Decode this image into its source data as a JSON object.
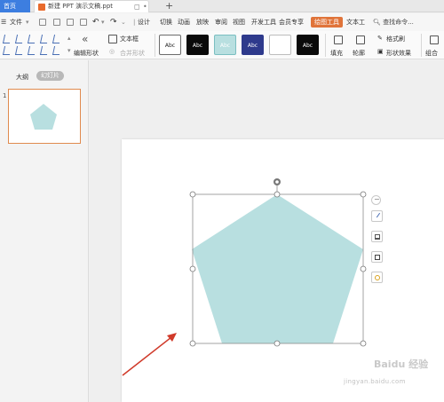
{
  "titlebar": {
    "home_tab": "首页",
    "doc_title": "新建 PPT 演示文稿.ppt",
    "new_tab": "+"
  },
  "menubar": {
    "file": "文件",
    "tabs": [
      "设计",
      "切换",
      "动画",
      "放映",
      "审阅",
      "视图",
      "开发工具",
      "会员专享"
    ],
    "active_tab": "绘图工具",
    "text_tool_tab": "文本工",
    "search": "查找命令..."
  },
  "ribbon": {
    "edit_shape": "编辑形状",
    "text_box": "文本框",
    "merge_shape": "合并形状",
    "style_label": "Abc",
    "fill": "填充",
    "outline": "轮廓",
    "format_painter": "格式刷",
    "shape_effect": "形状效果",
    "group": "组合"
  },
  "style_presets": [
    {
      "bg": "#ffffff",
      "fg": "#222222",
      "border": "#6c6c6c"
    },
    {
      "bg": "#0a0a0a",
      "fg": "#ffffff",
      "border": "#0a0a0a"
    },
    {
      "bg": "#b8dfe0",
      "fg": "#ffffff",
      "border": "#7bbfc1"
    },
    {
      "bg": "#2e3a8c",
      "fg": "#ffffff",
      "border": "#2e3a8c"
    },
    {
      "bg": "#ffffff",
      "fg": "#ffffff",
      "border": "#bdbdbd"
    },
    {
      "bg": "#0a0a0a",
      "fg": "#ffffff",
      "border": "#0a0a0a"
    }
  ],
  "panel": {
    "outline_tab": "大纲",
    "slides_tab": "幻灯片",
    "slide_number": "1"
  },
  "shape": {
    "type": "pentagon",
    "fill_color": "#b8dfe0",
    "selected": true
  },
  "float_tools": [
    "minus-icon",
    "brush-icon",
    "fill-icon",
    "outline-icon",
    "bulb-icon"
  ],
  "annotation": {
    "arrow_color": "#d03a2a"
  },
  "watermark": {
    "brand": "Baidu 经验",
    "url": "jingyan.baidu.com"
  },
  "colors": {
    "accent": "#e0743a",
    "home_tab": "#3d7ee0",
    "selection": "#888888"
  }
}
